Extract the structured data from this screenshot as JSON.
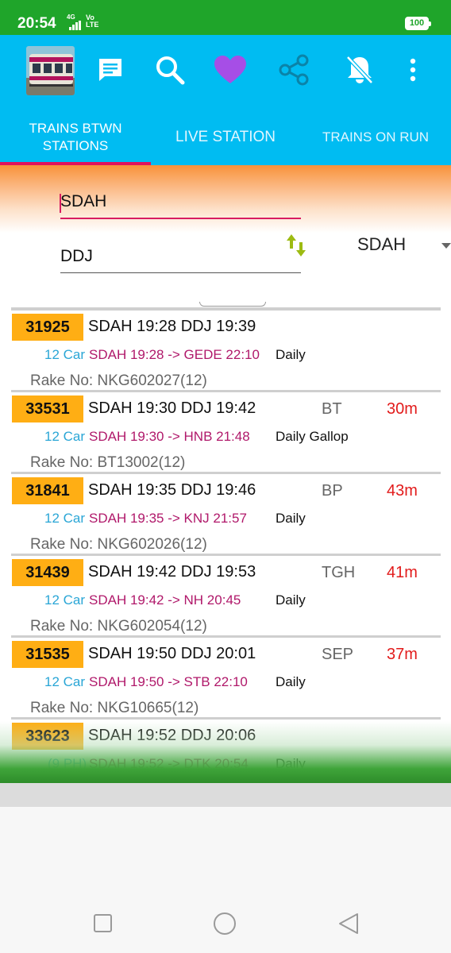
{
  "status_bar": {
    "time": "20:54",
    "network": "4G",
    "volte": "Vo LTE",
    "battery": "100"
  },
  "toolbar": {
    "logo": "local-train-logo",
    "icons": [
      "message-icon",
      "search-icon",
      "heart-icon",
      "share-icon",
      "notifications-off-icon",
      "more-vert-icon"
    ]
  },
  "tabs": [
    {
      "label": "TRAINS BTWN STATIONS",
      "selected": true
    },
    {
      "label": "LIVE STATION",
      "selected": false
    },
    {
      "label": "TRAINS ON RUN",
      "selected": false
    }
  ],
  "form": {
    "from_station": "SDAH",
    "to_station": "DDJ",
    "station_select": "SDAH",
    "swap_icon": "swap-vertical-icon"
  },
  "trains": [
    {
      "number": "31925",
      "route": "SDAH 19:28 DDJ 19:39",
      "location": "",
      "delay": "",
      "cars": "12 Car",
      "journey": "SDAH 19:28 -> GEDE 22:10",
      "frequency": "Daily",
      "rake": "Rake No: NKG602027(12)"
    },
    {
      "number": "33531",
      "route": "SDAH 19:30 DDJ 19:42",
      "location": "BT",
      "delay": "30m",
      "cars": "12 Car",
      "journey": "SDAH 19:30 -> HNB 21:48",
      "frequency": "Daily Gallop",
      "rake": "Rake No: BT13002(12)"
    },
    {
      "number": "31841",
      "route": "SDAH 19:35 DDJ 19:46",
      "location": "BP",
      "delay": "43m",
      "cars": "12 Car",
      "journey": "SDAH 19:35 -> KNJ 21:57",
      "frequency": "Daily",
      "rake": "Rake No: NKG602026(12)"
    },
    {
      "number": "31439",
      "route": "SDAH 19:42 DDJ 19:53",
      "location": "TGH",
      "delay": "41m",
      "cars": "12 Car",
      "journey": "SDAH 19:42 -> NH 20:45",
      "frequency": "Daily",
      "rake": "Rake No: NKG602054(12)"
    },
    {
      "number": "31535",
      "route": "SDAH 19:50 DDJ 20:01",
      "location": "SEP",
      "delay": "37m",
      "cars": "12 Car",
      "journey": "SDAH 19:50 -> STB 22:10",
      "frequency": "Daily",
      "rake": "Rake No: NKG10665(12)"
    },
    {
      "number": "33623",
      "route": "SDAH 19:52 DDJ 20:06",
      "location": "",
      "delay": "",
      "cars": "(9 PH)",
      "journey": "SDAH 19:52 -> DTK 20:54",
      "frequency": "Daily",
      "rake": ""
    }
  ],
  "nav_bar": {
    "buttons": [
      "recents-button",
      "home-button",
      "back-button"
    ]
  }
}
